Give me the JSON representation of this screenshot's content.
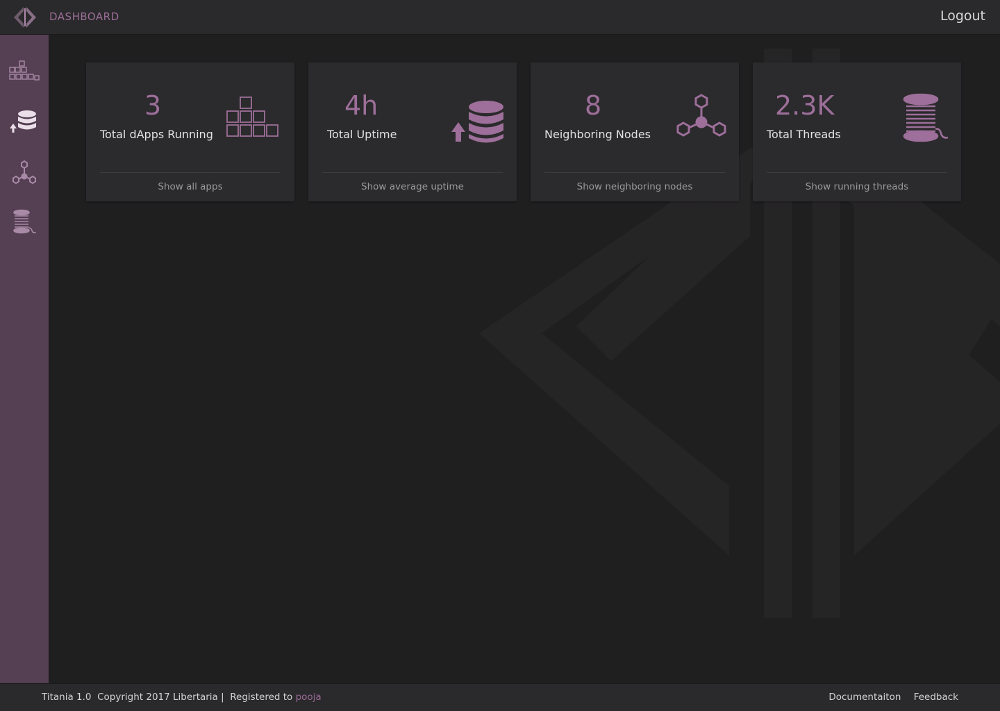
{
  "header": {
    "title": "DASHBOARD",
    "logout_label": "Logout",
    "logo_icon": "libertaria-logo-icon"
  },
  "sidebar": {
    "items": [
      {
        "id": "apps",
        "icon": "apps-grid-icon",
        "active": false
      },
      {
        "id": "uptime",
        "icon": "database-upload-icon",
        "active": true
      },
      {
        "id": "nodes",
        "icon": "network-nodes-icon",
        "active": false
      },
      {
        "id": "threads",
        "icon": "thread-spool-icon",
        "active": false
      }
    ]
  },
  "cards": [
    {
      "value": "3",
      "label": "Total dApps Running",
      "link": "Show all apps",
      "icon": "apps-grid-icon"
    },
    {
      "value": "4h",
      "label": "Total Uptime",
      "link": "Show average uptime",
      "icon": "database-upload-icon"
    },
    {
      "value": "8",
      "label": "Neighboring Nodes",
      "link": "Show neighboring nodes",
      "icon": "network-nodes-icon"
    },
    {
      "value": "2.3K",
      "label": "Total Threads",
      "link": "Show running threads",
      "icon": "thread-spool-icon"
    }
  ],
  "footer": {
    "version": "Titania 1.0",
    "copyright": "Copyright 2017 Libertaria |",
    "registered_prefix": "Registered to",
    "user": "pooja",
    "links": [
      "Documentaiton",
      "Feedback"
    ]
  },
  "colors": {
    "accent": "#9d6f9a",
    "sidebar": "#553f53",
    "header": "#2a292b",
    "card": "#2b2a2c",
    "background": "#1f1f20"
  }
}
